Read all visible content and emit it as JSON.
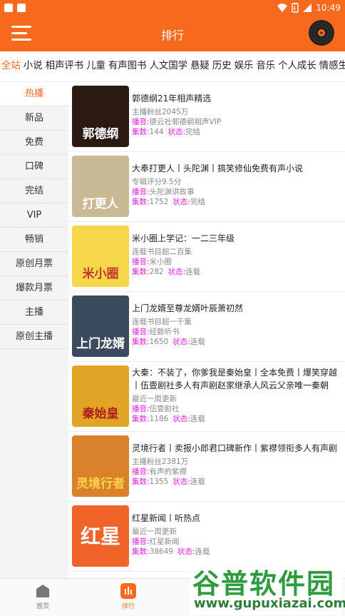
{
  "status_bar": {
    "time": "10:49"
  },
  "app_bar": {
    "title": "排行"
  },
  "category_tabs": [
    "全站",
    "小说",
    "相声评书",
    "儿童",
    "有声图书",
    "人文国学",
    "悬疑",
    "历史",
    "娱乐",
    "音乐",
    "个人成长",
    "情感生活"
  ],
  "sidebar": [
    "热播",
    "新品",
    "免费",
    "口碑",
    "完结",
    "VIP",
    "畅销",
    "原创月票",
    "爆款月票",
    "主播",
    "原创主播"
  ],
  "labels": {
    "anchor": "播音:",
    "episodes": "集数:",
    "status": "状态:"
  },
  "items": [
    {
      "title": "郭德纲21年相声精选",
      "meta": "主播粉丝2045万",
      "anchor": "德云社郭德纲相声VIP",
      "episodes": "144",
      "status": "完结",
      "cover_text": "郭德纲",
      "cover_color": "#2a1a12"
    },
    {
      "title": "大奉打更人丨头陀渊丨搞笑修仙免费有声小说",
      "meta": "专辑评分9.5分",
      "anchor": "头陀渊讲故事",
      "episodes": "1752",
      "status": "完结",
      "cover_text": "打更人",
      "cover_color": "#c9b994"
    },
    {
      "title": "米小圈上学记：一二三年级",
      "meta": "连载书目超二百集",
      "anchor": "米小圈",
      "episodes": "282",
      "status": "连载",
      "cover_text": "米小圈",
      "cover_color": "#f6d64a"
    },
    {
      "title": "上门龙婿至尊龙婿叶辰萧初然",
      "meta": "连载书目超一千集",
      "anchor": "经致听书",
      "episodes": "1650",
      "status": "连载",
      "cover_text": "上门龙婿",
      "cover_color": "#3b4a5c"
    },
    {
      "title": "大秦：不装了，你爹我是秦始皇丨全本免费丨爆笑穿越丨伍壹剧社多人有声剧赵家继承人风云父亲唯一秦朝",
      "meta": "最近一周更新",
      "anchor": "伍壹剧社",
      "episodes": "1186",
      "status": "连载",
      "cover_text": "秦始皇",
      "cover_color": "#e0a526"
    },
    {
      "title": "灵境行者丨卖报小郎君口碑新作丨紫襟领衔多人有声剧",
      "meta": "主播粉丝2381万",
      "anchor": "有声的紫襟",
      "episodes": "1355",
      "status": "连载",
      "cover_text": "灵境行者",
      "cover_color": "#d9822b"
    },
    {
      "title": "红星新闻丨听热点",
      "meta": "最近一周更新",
      "anchor": "红星新闻",
      "episodes": "38649",
      "status": "连载",
      "cover_text": "红星",
      "cover_color": "#f0642a"
    }
  ],
  "bottom_nav": [
    {
      "label": "首页",
      "icon": "home-icon",
      "color": "#777777"
    },
    {
      "label": "排行",
      "icon": "ranking-icon",
      "color": "#f7691d"
    }
  ],
  "watermark": {
    "main": "谷普软件园",
    "url": "www.gupuxiazai.com"
  },
  "colors": {
    "accent": "#f7691d",
    "label": "#e91ee0"
  }
}
